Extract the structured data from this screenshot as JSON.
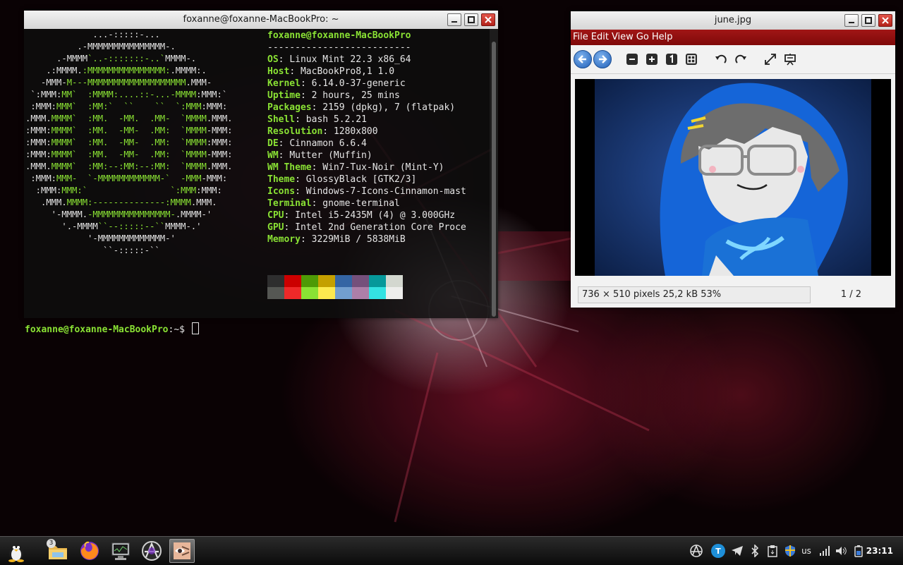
{
  "terminal": {
    "title": "foxanne@foxanne-MacBookPro: ~",
    "info_header": "foxanne@foxanne-MacBookPro",
    "separator": "--------------------------",
    "info": [
      {
        "key": "OS",
        "value": "Linux Mint 22.3 x86_64"
      },
      {
        "key": "Host",
        "value": "MacBookPro8,1 1.0"
      },
      {
        "key": "Kernel",
        "value": "6.14.0-37-generic"
      },
      {
        "key": "Uptime",
        "value": "2 hours, 25 mins"
      },
      {
        "key": "Packages",
        "value": "2159 (dpkg), 7 (flatpak)"
      },
      {
        "key": "Shell",
        "value": "bash 5.2.21"
      },
      {
        "key": "Resolution",
        "value": "1280x800"
      },
      {
        "key": "DE",
        "value": "Cinnamon 6.6.4"
      },
      {
        "key": "WM",
        "value": "Mutter (Muffin)"
      },
      {
        "key": "WM Theme",
        "value": "Win7-Tux-Noir (Mint-Y)"
      },
      {
        "key": "Theme",
        "value": "GlossyBlack [GTK2/3]"
      },
      {
        "key": "Icons",
        "value": "Windows-7-Icons-Cinnamon-mast"
      },
      {
        "key": "Terminal",
        "value": "gnome-terminal"
      },
      {
        "key": "CPU",
        "value": "Intel i5-2435M (4) @ 3.000GHz"
      },
      {
        "key": "GPU",
        "value": "Intel 2nd Generation Core Proce"
      },
      {
        "key": "Memory",
        "value": "3229MiB / 5838MiB"
      }
    ],
    "prompt_user": "foxanne@foxanne-MacBookPro",
    "prompt_path": ":~$ ",
    "palette_colors": [
      "#2e2e2e",
      "#cc0000",
      "#4e9a06",
      "#c4a000",
      "#3465a4",
      "#75507b",
      "#06989a",
      "#d3d7cf",
      "#555753",
      "#ef2929",
      "#8ae234",
      "#fce94f",
      "#729fcf",
      "#ad7fa8",
      "#34e2e2",
      "#eeeeec"
    ]
  },
  "viewer": {
    "title": "june.jpg",
    "menu": [
      "File",
      "Edit",
      "View",
      "Go",
      "Help"
    ],
    "status_info": "736 × 510 pixels  25,2 kB   53%",
    "page": "1 / 2",
    "colors": {
      "menubar": "#8b0d0d",
      "image_bg": "#0f2a5c",
      "hood": "#1565d8"
    }
  },
  "panel": {
    "file_manager_badge": "3",
    "keyboard_layout": "us",
    "clock": "23:11",
    "tray_t_label": "T",
    "launchers": [
      "menu-icon",
      "file-manager-icon",
      "firefox-icon",
      "system-monitor-icon",
      "anarchy-app-icon",
      "image-viewer-icon"
    ]
  }
}
